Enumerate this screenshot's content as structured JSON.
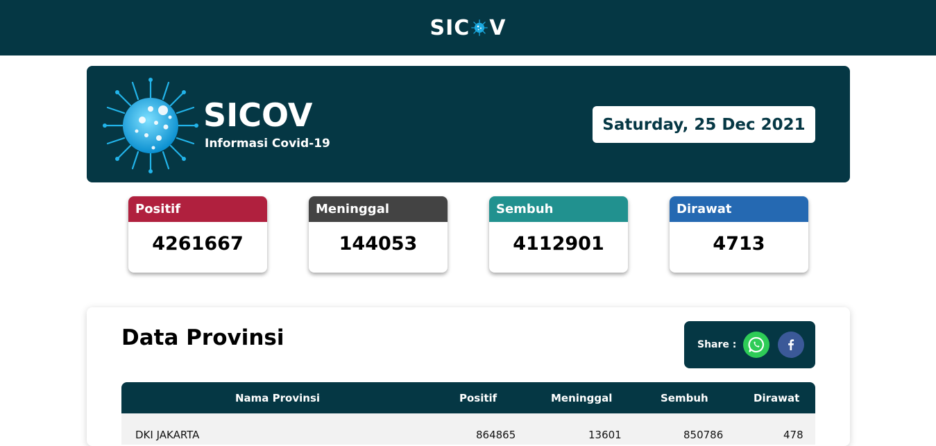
{
  "navbar": {
    "logo_left": "SIC",
    "logo_right": "V"
  },
  "hero": {
    "title": "SICOV",
    "subtitle": "Informasi Covid-19",
    "date": "Saturday, 25 Dec 2021"
  },
  "stats": [
    {
      "label": "Positif",
      "value": "4261667",
      "color": "#b0203e"
    },
    {
      "label": "Meninggal",
      "value": "144053",
      "color": "#434343"
    },
    {
      "label": "Sembuh",
      "value": "4112901",
      "color": "#21918f"
    },
    {
      "label": "Dirawat",
      "value": "4713",
      "color": "#2569b2"
    }
  ],
  "province": {
    "title": "Data Provinsi",
    "share_label": "Share :",
    "columns": [
      "Nama Provinsi",
      "Positif",
      "Meninggal",
      "Sembuh",
      "Dirawat"
    ],
    "rows": [
      {
        "name": "DKI JAKARTA",
        "positif": "864865",
        "meninggal": "13601",
        "sembuh": "850786",
        "dirawat": "478"
      }
    ]
  },
  "colors": {
    "brand_dark": "#053744",
    "whatsapp": "#2ecc57",
    "facebook": "#3b5998"
  },
  "icons": [
    "virus-logo-icon",
    "whatsapp-icon",
    "facebook-icon"
  ]
}
